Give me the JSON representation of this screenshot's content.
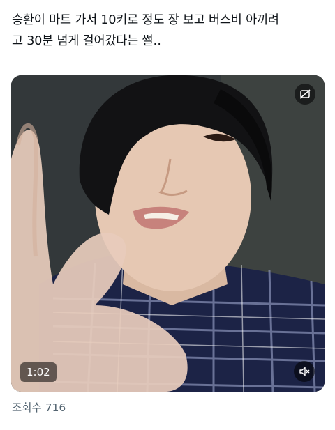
{
  "post": {
    "text_line1": "승환이 마트 가서 10키로 정도 장 보고 버스비 아끼려",
    "text_line2": "고 30분 넘게 걸어갔다는 썰‥"
  },
  "media": {
    "duration": "1:02",
    "top_icon": "autoplay-off-icon",
    "mute_icon": "speaker-muted-icon"
  },
  "stats": {
    "views": "조회수 716"
  },
  "colors": {
    "text": "#0f1419",
    "secondary_text": "#536471",
    "badge_bg": "#000000"
  }
}
